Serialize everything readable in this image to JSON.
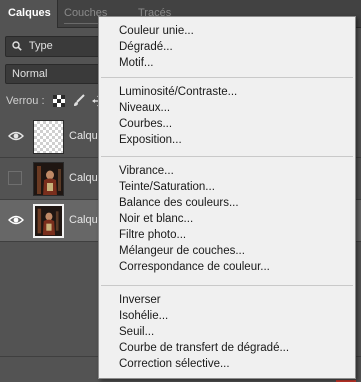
{
  "tabs": [
    "Calques",
    "Couches",
    "Tracés"
  ],
  "filter": {
    "label": "Type"
  },
  "blend_mode": "Normal",
  "lock_label": "Verrou :",
  "layers": [
    {
      "name": "Calque",
      "visible": true,
      "selected": false
    },
    {
      "name": "Calque",
      "visible": false,
      "selected": false
    },
    {
      "name": "Calque",
      "visible": true,
      "selected": true
    }
  ],
  "accent_color": "#d23a2e",
  "menu": {
    "groups": [
      [
        "Couleur unie...",
        "Dégradé...",
        "Motif..."
      ],
      [
        "Luminosité/Contraste...",
        "Niveaux...",
        "Courbes...",
        "Exposition..."
      ],
      [
        "Vibrance...",
        "Teinte/Saturation...",
        "Balance des couleurs...",
        "Noir et blanc...",
        "Filtre photo...",
        "Mélangeur de couches...",
        "Correspondance de couleur..."
      ],
      [
        "Inverser",
        "Isohélie...",
        "Seuil...",
        "Courbe de transfert de dégradé...",
        "Correction sélective..."
      ]
    ]
  }
}
